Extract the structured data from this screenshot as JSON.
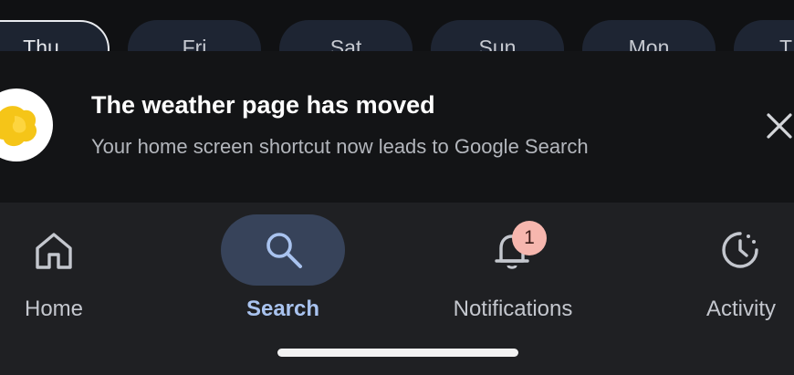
{
  "days": [
    {
      "label": "Thu",
      "selected": true
    },
    {
      "label": "Fri",
      "selected": false
    },
    {
      "label": "Sat",
      "selected": false
    },
    {
      "label": "Sun",
      "selected": false
    },
    {
      "label": "Mon",
      "selected": false
    },
    {
      "label": "T",
      "selected": false
    }
  ],
  "banner": {
    "title": "The weather page has moved",
    "subtitle": "Your home screen shortcut now leads to Google Search",
    "icon": "weather-sun-icon",
    "close_icon": "close-icon"
  },
  "nav": {
    "items": [
      {
        "label": "Home",
        "icon": "home-icon",
        "active": false
      },
      {
        "label": "Search",
        "icon": "search-icon",
        "active": true
      },
      {
        "label": "Notifications",
        "icon": "bell-icon",
        "active": false,
        "badge": "1"
      },
      {
        "label": "Activity",
        "icon": "activity-history-icon",
        "active": false
      }
    ]
  },
  "colors": {
    "accent": "#a9c3ef",
    "active_pill": "#37435a",
    "badge": "#f6b6ae",
    "sun_yellow": "#f5c518"
  }
}
